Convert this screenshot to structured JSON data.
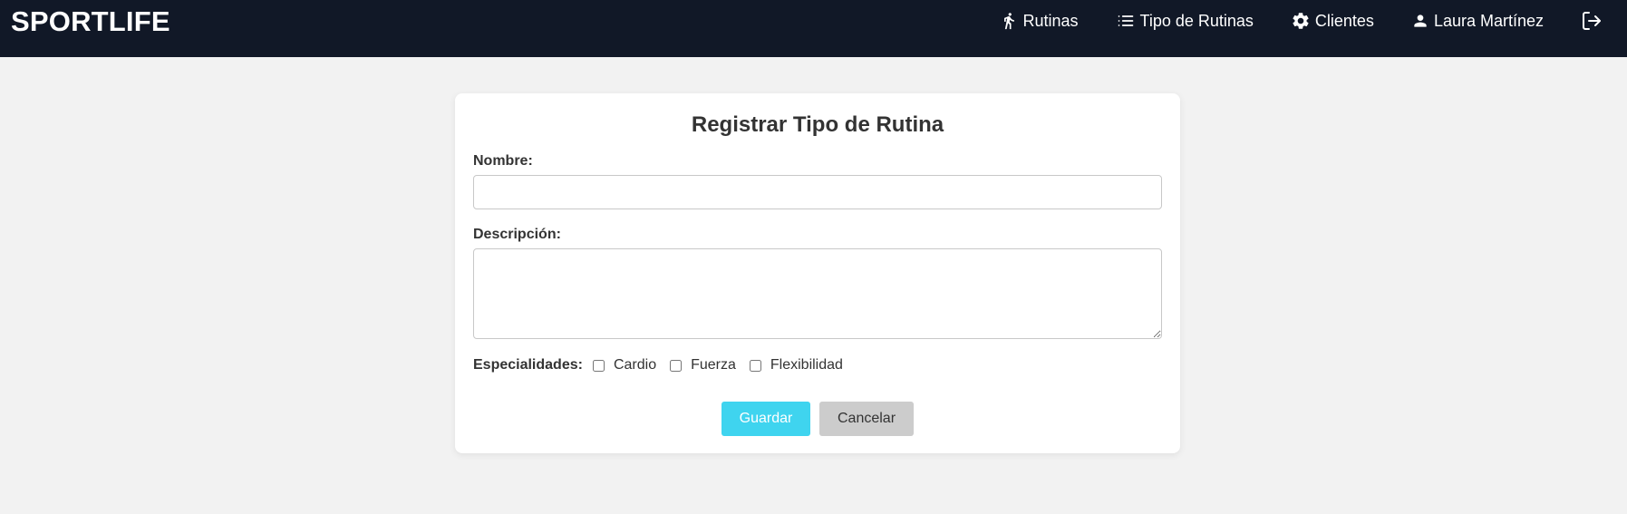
{
  "navbar": {
    "brand": "SPORTLIFE",
    "items": [
      {
        "label": "Rutinas",
        "icon": "running-person-icon"
      },
      {
        "label": "Tipo de Rutinas",
        "icon": "list-icon"
      },
      {
        "label": "Clientes",
        "icon": "gear-icon"
      },
      {
        "label": "Laura Martínez",
        "icon": "user-icon"
      }
    ],
    "logout_icon": "logout-icon"
  },
  "form": {
    "title": "Registrar Tipo de Rutina",
    "nombre_label": "Nombre:",
    "nombre_value": "",
    "descripcion_label": "Descripción:",
    "descripcion_value": "",
    "especialidades_label": "Especialidades:",
    "especialidades": [
      {
        "label": "Cardio",
        "checked": false
      },
      {
        "label": "Fuerza",
        "checked": false
      },
      {
        "label": "Flexibilidad",
        "checked": false
      }
    ],
    "save_label": "Guardar",
    "cancel_label": "Cancelar"
  },
  "colors": {
    "navbar_bg": "#111827",
    "page_bg": "#f2f2f2",
    "save_button": "#3fd4ef",
    "cancel_button": "#cccccc"
  }
}
